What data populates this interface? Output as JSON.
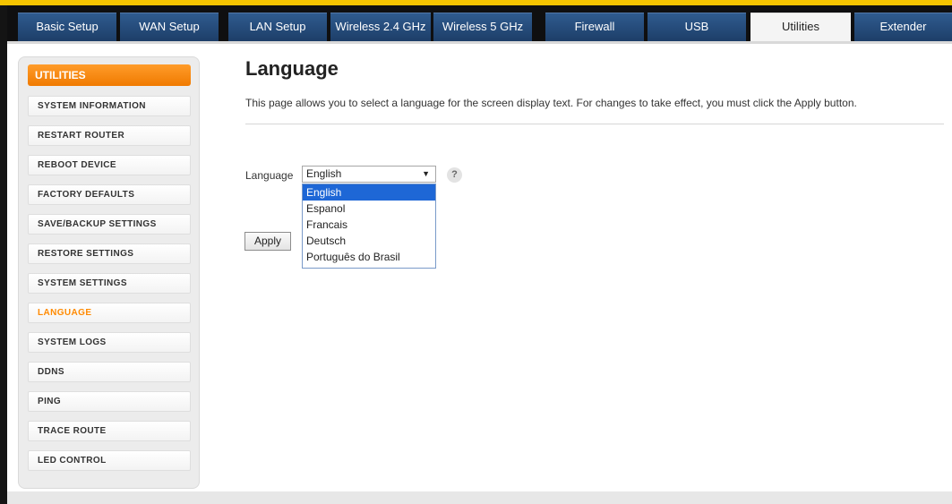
{
  "nav": {
    "tabs": [
      {
        "label": "Basic Setup"
      },
      {
        "label": "WAN Setup"
      },
      {
        "label": "LAN Setup"
      },
      {
        "label": "Wireless 2.4 GHz"
      },
      {
        "label": "Wireless 5 GHz"
      },
      {
        "label": "Firewall"
      },
      {
        "label": "USB"
      },
      {
        "label": "Utilities",
        "active": true
      },
      {
        "label": "Extender"
      }
    ]
  },
  "sidebar": {
    "title": "UTILITIES",
    "items": [
      {
        "label": "SYSTEM INFORMATION"
      },
      {
        "label": "RESTART ROUTER"
      },
      {
        "label": "REBOOT DEVICE"
      },
      {
        "label": "FACTORY DEFAULTS"
      },
      {
        "label": "SAVE/BACKUP SETTINGS"
      },
      {
        "label": "RESTORE SETTINGS"
      },
      {
        "label": "SYSTEM SETTINGS"
      },
      {
        "label": "LANGUAGE",
        "active": true
      },
      {
        "label": "SYSTEM LOGS"
      },
      {
        "label": "DDNS"
      },
      {
        "label": "PING"
      },
      {
        "label": "TRACE ROUTE"
      },
      {
        "label": "LED CONTROL"
      }
    ]
  },
  "main": {
    "title": "Language",
    "description": "This page allows you to select a language for the screen display text. For changes to take effect, you must click the Apply button.",
    "language_label": "Language",
    "language_select": {
      "value": "English",
      "options": [
        "English",
        "Espanol",
        "Francais",
        "Deutsch",
        "Português do Brasil"
      ]
    },
    "help_symbol": "?",
    "apply_label": "Apply"
  },
  "colors": {
    "accent": "#ff8a00",
    "tab_blue": "#1d3e68",
    "selection_blue": "#1e67d6",
    "top_strip": "#f5c400"
  },
  "icons": {
    "help": "question-mark-icon",
    "dropdown_arrow": "chevron-down-icon"
  }
}
